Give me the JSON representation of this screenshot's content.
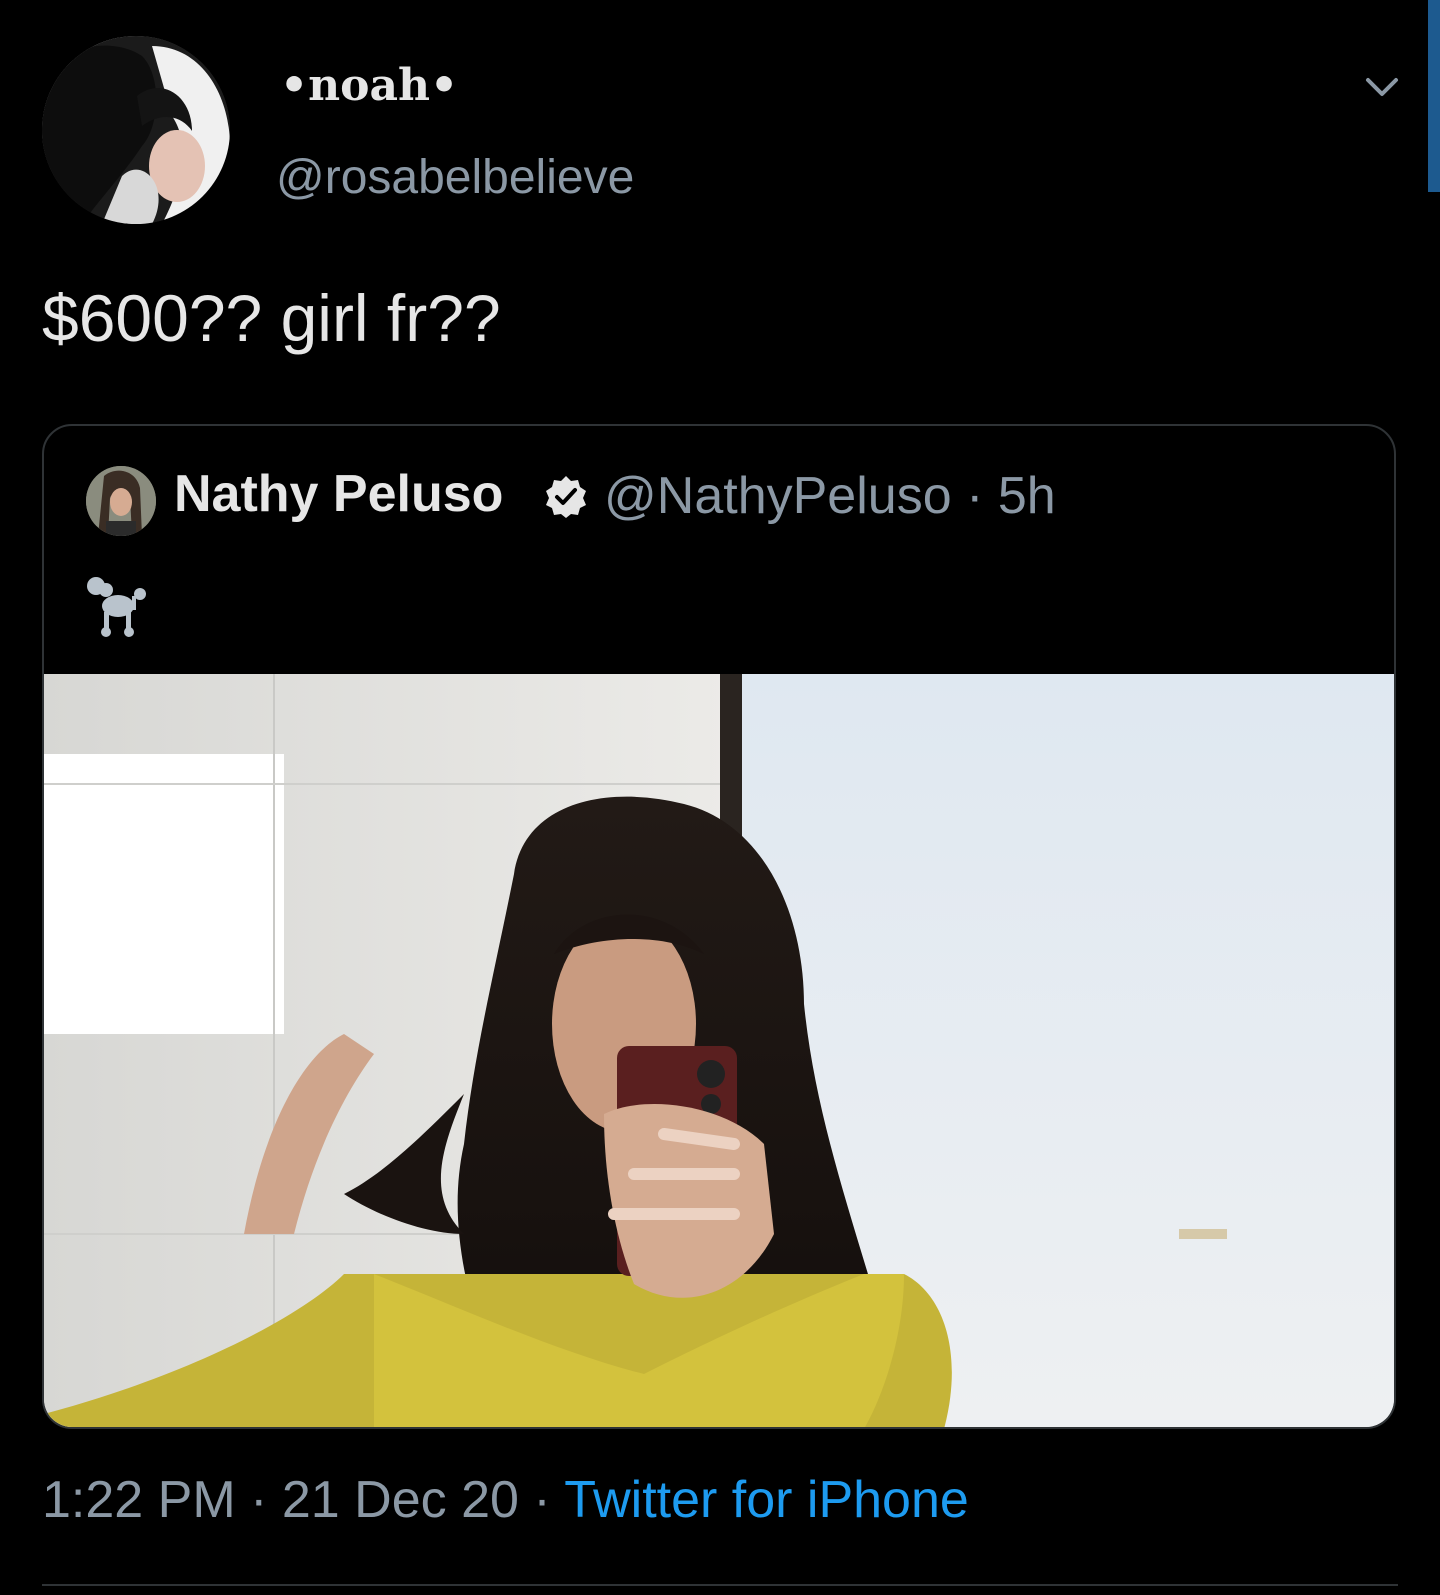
{
  "tweet": {
    "author": {
      "display_name": "•noah•",
      "handle": "@rosabelbelieve"
    },
    "text": "$600?? girl fr??",
    "quoted": {
      "author_name": "Nathy Peluso",
      "handle_time": "@NathyPeluso · 5h",
      "verified": true,
      "emoji": "poodle"
    },
    "meta": {
      "timestamp": "1:22 PM · 21 Dec 20 · ",
      "source": "Twitter for iPhone"
    }
  },
  "icons": {
    "menu": "chevron-down-icon",
    "verified": "verified-badge-icon"
  },
  "colors": {
    "background": "#000000",
    "text_primary": "#e6e6e6",
    "text_secondary": "#8b98a5",
    "link": "#1d9bf0",
    "border": "#2f3336",
    "scrollbar": "#1d5a8f"
  }
}
